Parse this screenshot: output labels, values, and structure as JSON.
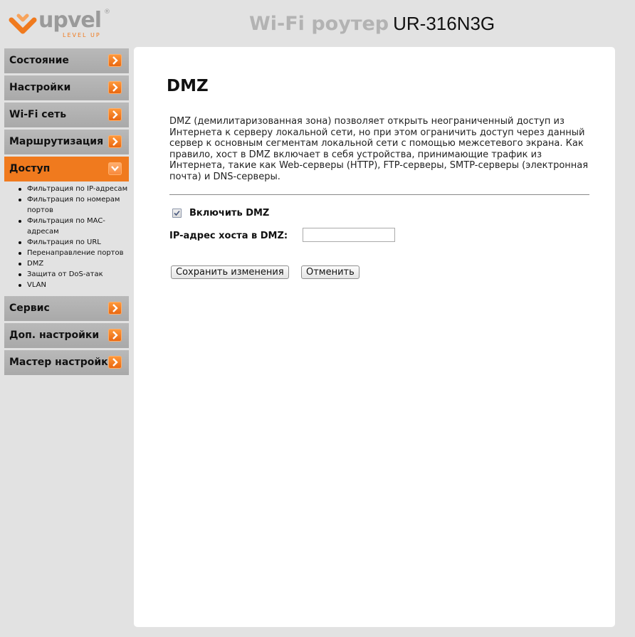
{
  "brand": {
    "name": "upvel",
    "registered": "®",
    "tagline": "LEVEL UP",
    "accent_color": "#f07a1e"
  },
  "header": {
    "title_prefix": "Wi-Fi роутер",
    "model": "UR-316N3G"
  },
  "sidebar": {
    "items": [
      {
        "label": "Состояние",
        "icon": "chevron-right-icon"
      },
      {
        "label": "Настройки",
        "icon": "chevron-right-icon"
      },
      {
        "label": "Wi-Fi сеть",
        "icon": "chevron-right-icon"
      },
      {
        "label": "Маршрутизация",
        "icon": "chevron-right-icon"
      },
      {
        "label": "Доступ",
        "icon": "chevron-down-icon",
        "active": true
      },
      {
        "label": "Сервис",
        "icon": "chevron-right-icon"
      },
      {
        "label": "Доп. настройки",
        "icon": "chevron-right-icon"
      },
      {
        "label": "Мастер настройки",
        "icon": "chevron-right-icon"
      }
    ],
    "submenu": [
      "Фильтрация по IP-адресам",
      "Фильтрация по номерам портов",
      "Фильтрация по MAC-адресам",
      "Фильтрация по URL",
      "Перенаправление портов",
      "DMZ",
      "Защита от DoS-атак",
      "VLAN"
    ]
  },
  "main": {
    "heading": "DMZ",
    "description": "DMZ (демилитаризованная зона) позволяет открыть неограниченный доступ из Интернета к серверу локальной сети, но при этом ограничить доступ через данный сервер к основным сегментам локальной сети с помощью межсетевого экрана. Как правило, хост в DMZ включает в себя устройства, принимающие трафик из Интернета, такие как Web-серверы (HTTP), FTP-серверы, SMTP-серверы (электронная почта) и DNS-серверы.",
    "enable_label": "Включить DMZ",
    "enable_checked": true,
    "ip_label": "IP-адрес хоста в DMZ:",
    "ip_value": "",
    "save_label": "Сохранить изменения",
    "cancel_label": "Отменить"
  }
}
